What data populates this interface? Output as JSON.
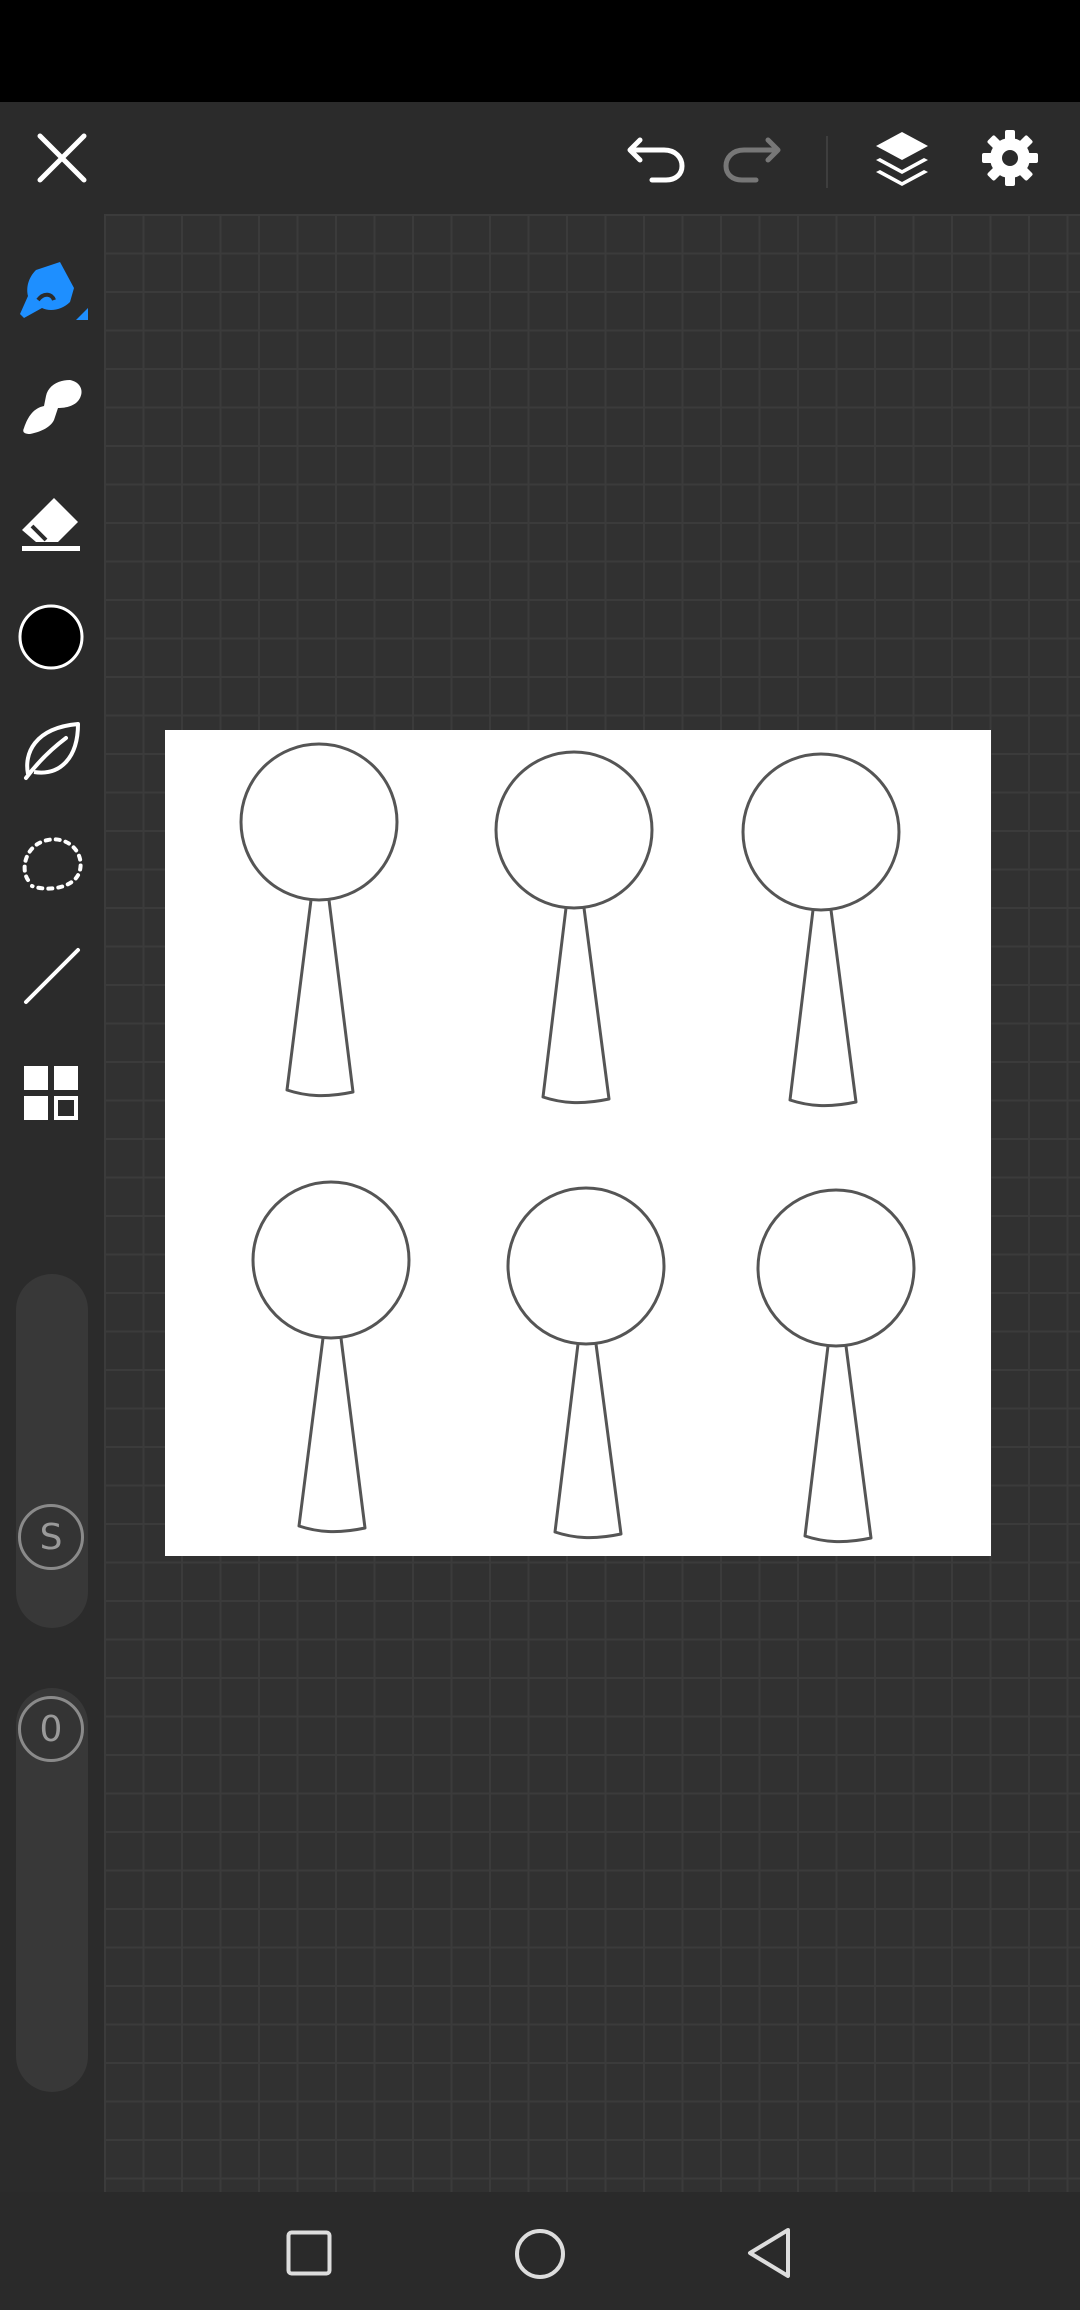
{
  "toolbar": {
    "close_icon": "close-icon",
    "undo_icon": "undo-icon",
    "redo_icon": "redo-icon",
    "layers_icon": "layers-icon",
    "settings_icon": "gear-icon"
  },
  "tools": [
    {
      "name": "pen",
      "icon": "pen-icon",
      "selected": true
    },
    {
      "name": "smudge",
      "icon": "smudge-icon",
      "selected": false
    },
    {
      "name": "eraser",
      "icon": "eraser-icon",
      "selected": false
    },
    {
      "name": "color",
      "icon": "color-swatch",
      "selected": false
    },
    {
      "name": "fill",
      "icon": "leaf-icon",
      "selected": false
    },
    {
      "name": "lasso",
      "icon": "lasso-icon",
      "selected": false
    },
    {
      "name": "line",
      "icon": "line-icon",
      "selected": false
    },
    {
      "name": "more",
      "icon": "grid-icon",
      "selected": false
    }
  ],
  "colors": {
    "accent": "#1e8fff",
    "current_color": "#000000",
    "icon": "#ffffff",
    "icon_disabled": "#777777",
    "background": "#2e2e2e",
    "paper": "#ffffff",
    "stroke": "#555555"
  },
  "sliders": {
    "size_label": "S",
    "opacity_label": "0"
  },
  "nav": {
    "recents_icon": "square-icon",
    "home_icon": "circle-icon",
    "back_icon": "triangle-back-icon"
  }
}
